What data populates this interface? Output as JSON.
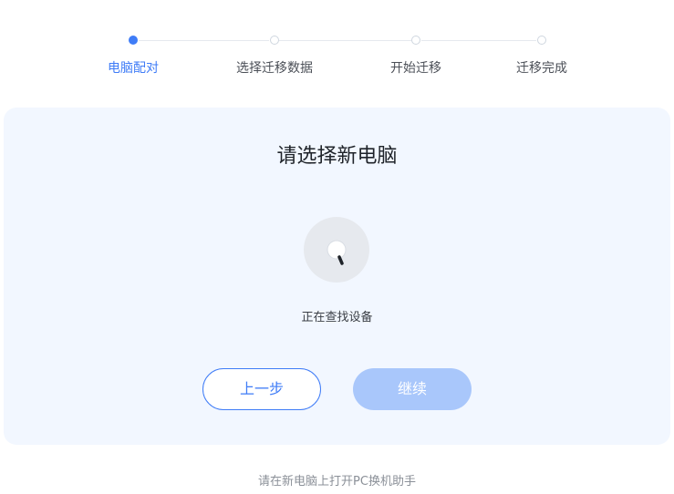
{
  "stepper": {
    "steps": [
      {
        "label": "电脑配对",
        "state": "active"
      },
      {
        "label": "选择迁移数据",
        "state": "inactive"
      },
      {
        "label": "开始迁移",
        "state": "inactive"
      },
      {
        "label": "迁移完成",
        "state": "inactive"
      }
    ]
  },
  "card": {
    "title": "请选择新电脑",
    "status": "正在查找设备",
    "spinner_icon": "loading-spinner-icon"
  },
  "buttons": {
    "previous_label": "上一步",
    "continue_label": "继续",
    "continue_enabled": false
  },
  "footer": {
    "hint": "请在新电脑上打开PC换机助手"
  },
  "colors": {
    "accent": "#3f7cf7",
    "accent_disabled": "#a9c7fb",
    "card_background": "#f2f7ff",
    "page_background": "#ffffff"
  }
}
